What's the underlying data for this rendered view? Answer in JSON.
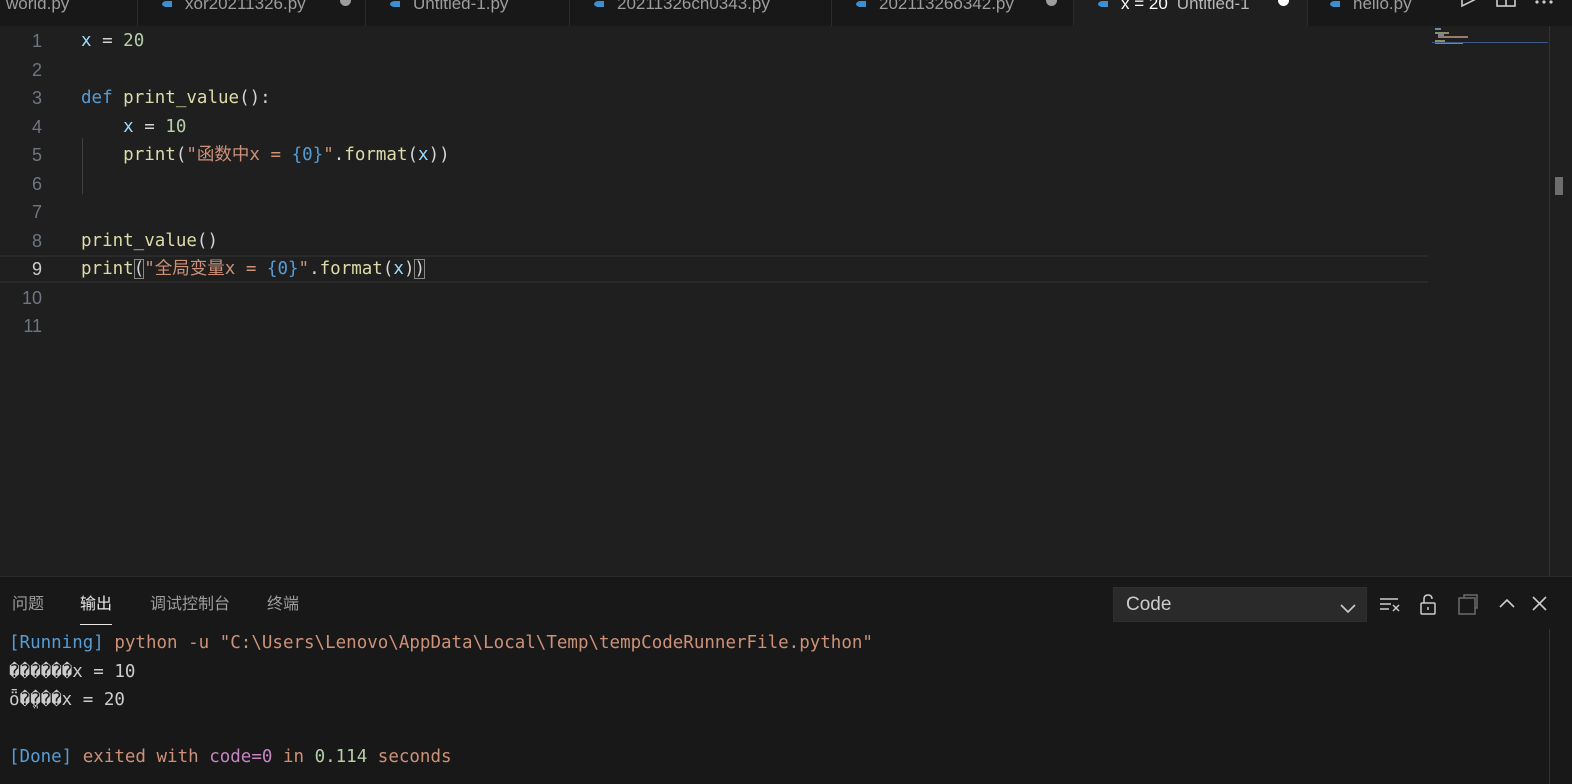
{
  "tabs": [
    {
      "label": "world.py",
      "icon": "python-icon",
      "dirty": false,
      "active": false
    },
    {
      "label": "xor20211326.py",
      "icon": "python-icon",
      "dirty": true,
      "active": false
    },
    {
      "label": "Untitled-1.py",
      "icon": "python-icon",
      "dirty": false,
      "active": false
    },
    {
      "label": "20211326ch0343.py",
      "icon": "python-icon",
      "dirty": false,
      "active": false
    },
    {
      "label": "20211326o342.py",
      "icon": "python-icon",
      "dirty": true,
      "active": false
    },
    {
      "label": "x = 20",
      "description": "Untitled-1",
      "icon": "python-icon",
      "dirty": true,
      "active": true
    },
    {
      "label": "hello.py",
      "icon": "python-icon",
      "dirty": false,
      "active": false
    }
  ],
  "editor_actions": [
    "run-icon",
    "split-editor-icon",
    "more-actions-icon"
  ],
  "editor": {
    "active_line": 9,
    "line_numbers": [
      "1",
      "2",
      "3",
      "4",
      "5",
      "6",
      "7",
      "8",
      "9",
      "10",
      "11"
    ],
    "lines": [
      [
        {
          "t": "x",
          "c": "var"
        },
        {
          "t": " = ",
          "c": "pun"
        },
        {
          "t": "20",
          "c": "num"
        }
      ],
      [],
      [
        {
          "t": "def",
          "c": "kw"
        },
        {
          "t": " ",
          "c": "pun"
        },
        {
          "t": "print_value",
          "c": "fn"
        },
        {
          "t": "():",
          "c": "pun"
        }
      ],
      [
        {
          "t": "    ",
          "c": "pun"
        },
        {
          "t": "x",
          "c": "var"
        },
        {
          "t": " = ",
          "c": "pun"
        },
        {
          "t": "10",
          "c": "num"
        }
      ],
      [
        {
          "t": "    ",
          "c": "pun"
        },
        {
          "t": "print",
          "c": "fn"
        },
        {
          "t": "(",
          "c": "pun"
        },
        {
          "t": "\"函数中x = ",
          "c": "str"
        },
        {
          "t": "{0}",
          "c": "fmt"
        },
        {
          "t": "\"",
          "c": "str"
        },
        {
          "t": ".",
          "c": "pun"
        },
        {
          "t": "format",
          "c": "fn"
        },
        {
          "t": "(",
          "c": "pun"
        },
        {
          "t": "x",
          "c": "var"
        },
        {
          "t": "))",
          "c": "pun"
        }
      ],
      [],
      [],
      [
        {
          "t": "print_value",
          "c": "fn"
        },
        {
          "t": "()",
          "c": "pun"
        }
      ],
      [
        {
          "t": "print",
          "c": "fn"
        },
        {
          "t": "(",
          "c": "pun",
          "bracket": true
        },
        {
          "t": "\"全局变量x = ",
          "c": "str"
        },
        {
          "t": "{0}",
          "c": "fmt"
        },
        {
          "t": "\"",
          "c": "str"
        },
        {
          "t": ".",
          "c": "pun"
        },
        {
          "t": "format",
          "c": "fn"
        },
        {
          "t": "(",
          "c": "pun"
        },
        {
          "t": "x",
          "c": "var"
        },
        {
          "t": ")",
          "c": "pun"
        },
        {
          "t": ")",
          "c": "pun",
          "bracket": true
        }
      ],
      [],
      []
    ]
  },
  "panel": {
    "tabs": [
      {
        "label": "问题",
        "active": false
      },
      {
        "label": "输出",
        "active": true
      },
      {
        "label": "调试控制台",
        "active": false
      },
      {
        "label": "终端",
        "active": false
      }
    ],
    "channel_select": {
      "value": "Code"
    },
    "actions": [
      "clear-output-icon",
      "lock-scroll-icon",
      "open-output-in-editor-icon",
      "maximize-panel-icon",
      "close-panel-icon"
    ],
    "output_lines": [
      [
        {
          "t": "[Running]",
          "c": "bracket"
        },
        {
          "t": " python -u \"C:\\Users\\Lenovo\\AppData\\Local\\Temp\\tempCodeRunnerFile.python\"",
          "c": "cmd"
        }
      ],
      [
        {
          "t": "������x = 10",
          "c": "plain"
        }
      ],
      [
        {
          "t": "ȫ�ֱ���x = 20",
          "c": "plain"
        }
      ],
      [],
      [
        {
          "t": "[Done]",
          "c": "bracket"
        },
        {
          "t": " exited with ",
          "c": "cmd"
        },
        {
          "t": "code=0",
          "c": "code"
        },
        {
          "t": " in ",
          "c": "cmd"
        },
        {
          "t": "0.114",
          "c": "num"
        },
        {
          "t": " seconds",
          "c": "cmd"
        }
      ]
    ]
  }
}
